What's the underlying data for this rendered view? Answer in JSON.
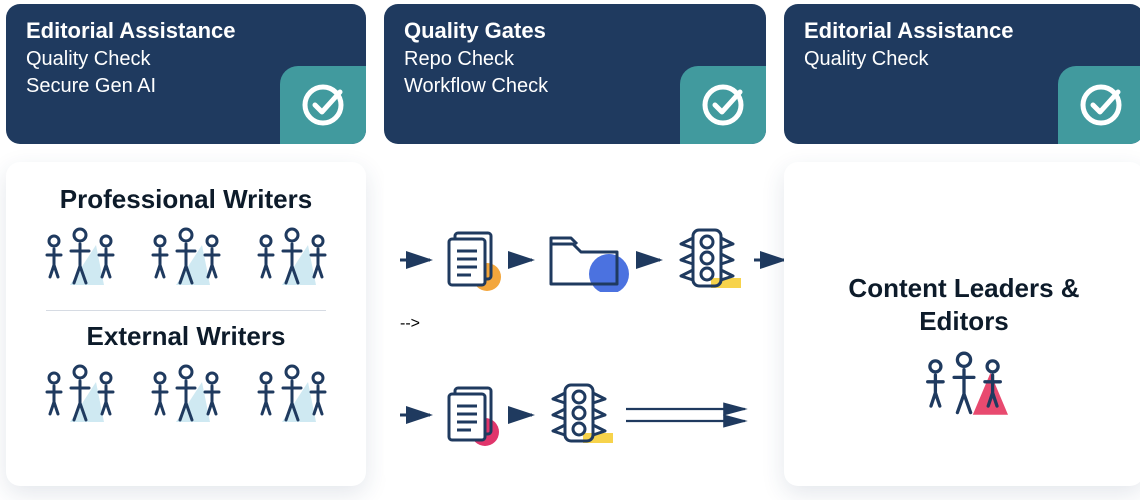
{
  "headers": {
    "left": {
      "title": "Editorial Assistance",
      "lines": [
        "Quality Check",
        "Secure Gen AI"
      ]
    },
    "center": {
      "title": "Quality Gates",
      "lines": [
        "Repo Check",
        "Workflow Check"
      ]
    },
    "right": {
      "title": "Editorial Assistance",
      "lines": [
        "Quality Check"
      ]
    }
  },
  "body": {
    "left": {
      "section1_title": "Professional Writers",
      "section2_title": "External Writers"
    },
    "right": {
      "title_line1": "Content Leaders &",
      "title_line2": "Editors"
    }
  },
  "icons": {
    "people_group": "people-group-icon",
    "document": "document-icon",
    "folder": "folder-icon",
    "traffic": "traffic-light-icon",
    "check_badge": "checkmark-badge-icon",
    "arrow": "arrow-right-icon"
  },
  "colors": {
    "navy": "#1f3a5f",
    "teal": "#419a9e",
    "outline": "#1f3a5f",
    "accent_blue": "#4b72e0",
    "accent_orange": "#f3a63c",
    "accent_yellow": "#f7d34b",
    "accent_pink": "#e0356b",
    "light_blue": "#cfe9f2",
    "light_red": "#e84a6f"
  }
}
